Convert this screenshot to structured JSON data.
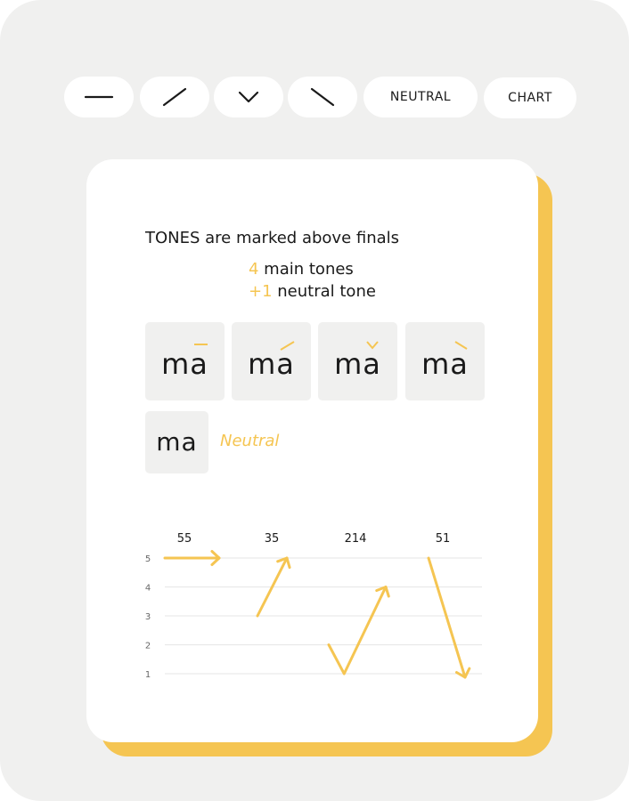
{
  "toolbar": {
    "buttons": [
      {
        "id": "tone1",
        "icon": "flat-line-icon",
        "label": ""
      },
      {
        "id": "tone2",
        "icon": "rising-line-icon",
        "label": ""
      },
      {
        "id": "tone3",
        "icon": "dip-chevron-icon",
        "label": ""
      },
      {
        "id": "tone4",
        "icon": "falling-line-icon",
        "label": ""
      },
      {
        "id": "neutral",
        "label": "NEUTRAL"
      },
      {
        "id": "chart",
        "label": "CHART"
      }
    ]
  },
  "card": {
    "headline": "TONES are marked above finals",
    "main_count": "4",
    "main_label": " main tones",
    "neutral_count": "+1",
    "neutral_label": " neutral tone",
    "tiles": [
      {
        "syllable": "ma",
        "mark": "macron"
      },
      {
        "syllable": "ma",
        "mark": "acute"
      },
      {
        "syllable": "ma",
        "mark": "caron"
      },
      {
        "syllable": "ma",
        "mark": "grave"
      }
    ],
    "neutral_tile": {
      "syllable": "ma",
      "caption": "Neutral"
    }
  },
  "colors": {
    "accent": "#f5c552",
    "frame_bg": "#f0f0ef",
    "tile_bg": "#f0f0ef",
    "text": "#1a1a1a",
    "grid": "#e6e6e6"
  },
  "chart_data": {
    "type": "line",
    "title": "",
    "xlabel": "",
    "ylabel": "",
    "ylim": [
      1,
      5
    ],
    "yticks": [
      5,
      4,
      3,
      2,
      1
    ],
    "grid": true,
    "categories": [
      "55",
      "35",
      "214",
      "51"
    ],
    "series": [
      {
        "name": "55",
        "points": [
          [
            0,
            5
          ],
          [
            1,
            5
          ]
        ]
      },
      {
        "name": "35",
        "points": [
          [
            0,
            3
          ],
          [
            1,
            5
          ]
        ]
      },
      {
        "name": "214",
        "points": [
          [
            0,
            2
          ],
          [
            0.27,
            1
          ],
          [
            1,
            4
          ]
        ]
      },
      {
        "name": "51",
        "points": [
          [
            0,
            5
          ],
          [
            1,
            1
          ]
        ]
      }
    ]
  }
}
